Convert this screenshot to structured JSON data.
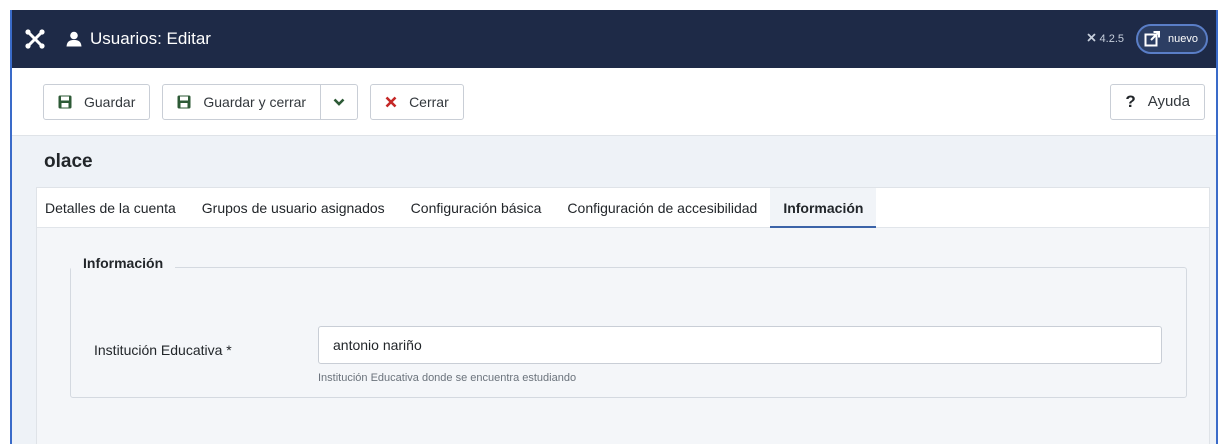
{
  "header": {
    "title": "Usuarios: Editar",
    "version": "4.2.5",
    "new_label": "nuevo"
  },
  "toolbar": {
    "save_label": "Guardar",
    "save_close_label": "Guardar y cerrar",
    "close_label": "Cerrar",
    "help_label": "Ayuda"
  },
  "page": {
    "title": "olace"
  },
  "tabs": [
    {
      "label": "Detalles de la cuenta",
      "active": false
    },
    {
      "label": "Grupos de usuario asignados",
      "active": false
    },
    {
      "label": "Configuración básica",
      "active": false
    },
    {
      "label": "Configuración de accesibilidad",
      "active": false
    },
    {
      "label": "Información",
      "active": true
    }
  ],
  "form": {
    "legend": "Información",
    "institution_label": "Institución Educativa *",
    "institution_value": "antonio nariño",
    "institution_help": "Institución Educativa donde se encuentra estudiando"
  },
  "colors": {
    "header_bg": "#1e2a47",
    "accent": "#3b63a8",
    "save_icon": "#2d5a36",
    "close_icon": "#c52827"
  }
}
